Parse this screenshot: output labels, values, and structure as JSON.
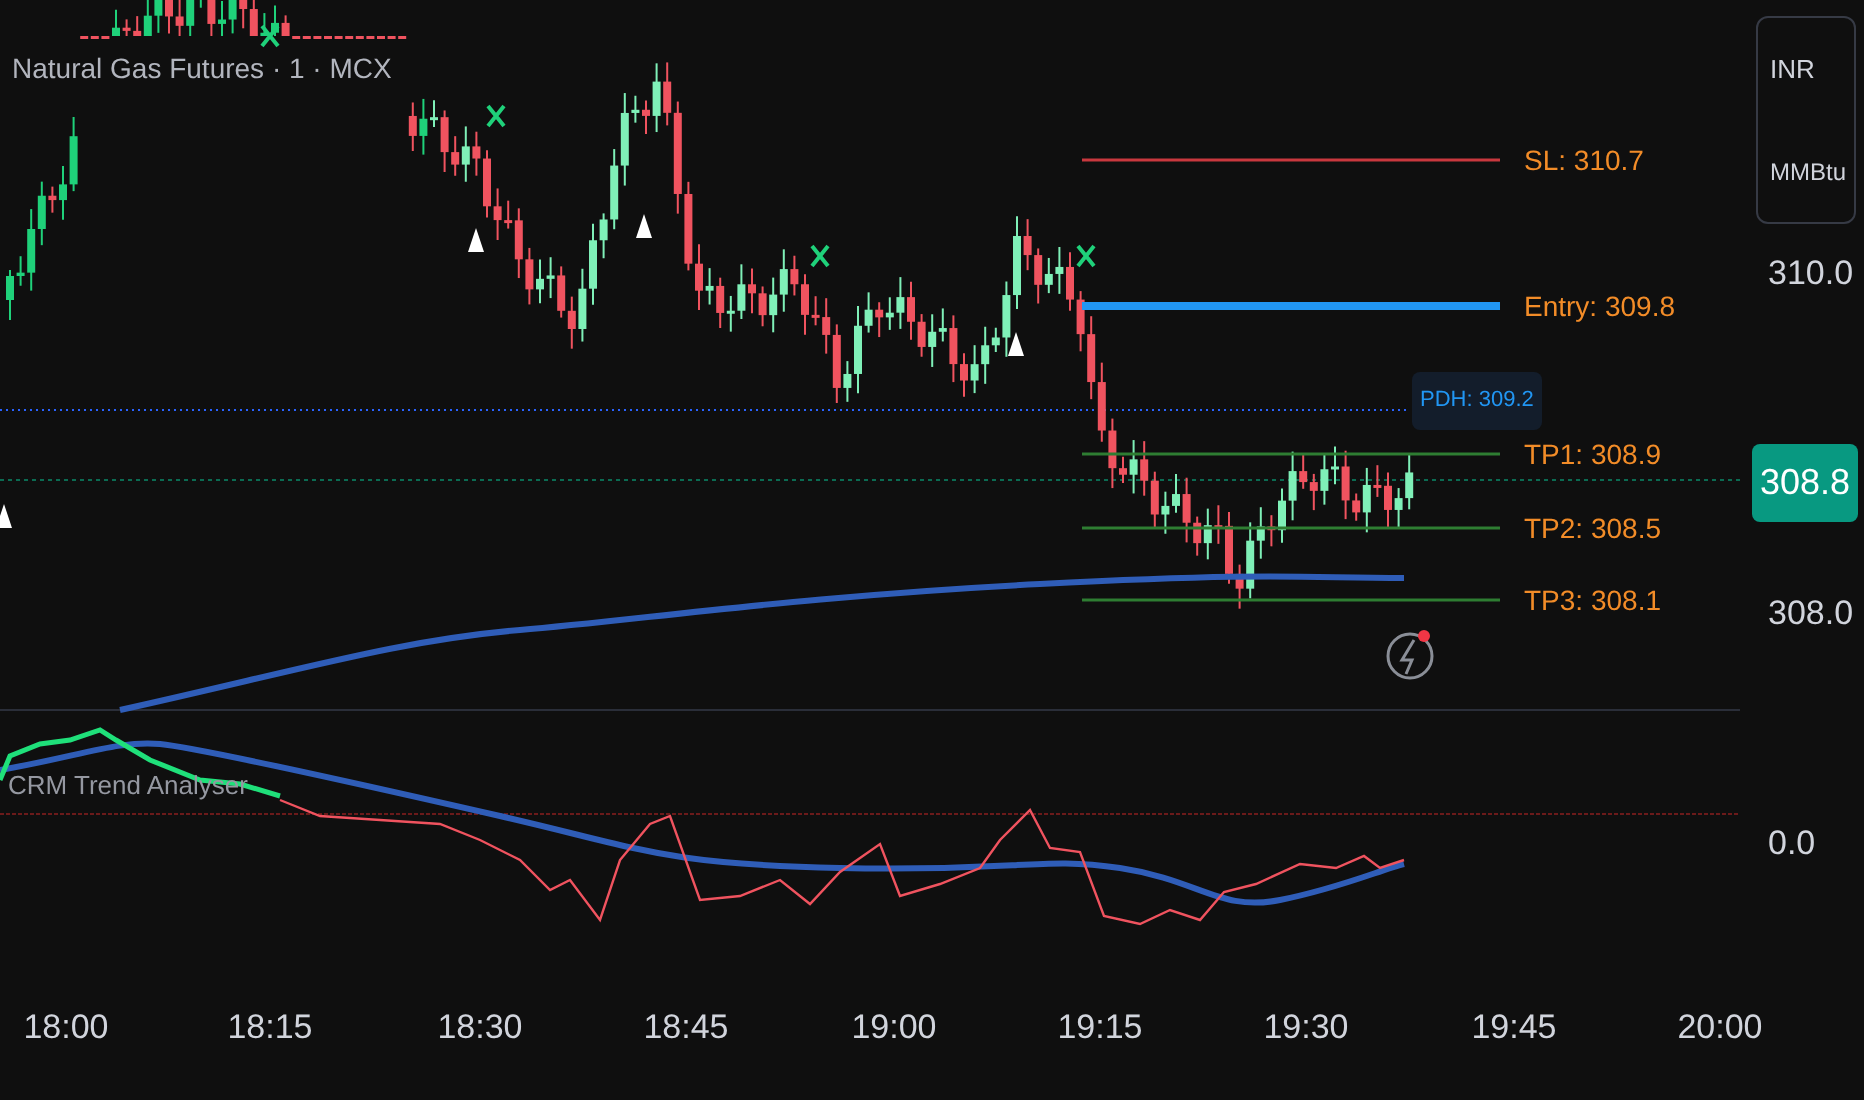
{
  "legend": {
    "title": "Natural Gas Futures · 1 · MCX"
  },
  "price_axis": {
    "currency": "INR",
    "unit": "MMBtu",
    "ticks": [
      "310.0",
      "308.0"
    ],
    "current_price": "308.8"
  },
  "levels": [
    {
      "kind": "stop",
      "label": "SL: 310.7",
      "color": "#c8383e"
    },
    {
      "kind": "entry",
      "label": "Entry: 309.8",
      "color": "#2196f3"
    },
    {
      "kind": "target",
      "label": "TP1: 308.9",
      "color": "#2e7d32"
    },
    {
      "kind": "target",
      "label": "TP2: 308.5",
      "color": "#2e7d32"
    },
    {
      "kind": "target",
      "label": "TP3: 308.1",
      "color": "#2e7d32"
    }
  ],
  "pdh_label": "PDH: 309.2",
  "indicator": {
    "name": "CRM Trend Analyser",
    "axis_tick": "0.0"
  },
  "time_axis": [
    "18:00",
    "18:15",
    "18:30",
    "18:45",
    "19:00",
    "19:15",
    "19:30",
    "19:45",
    "20:00"
  ]
}
